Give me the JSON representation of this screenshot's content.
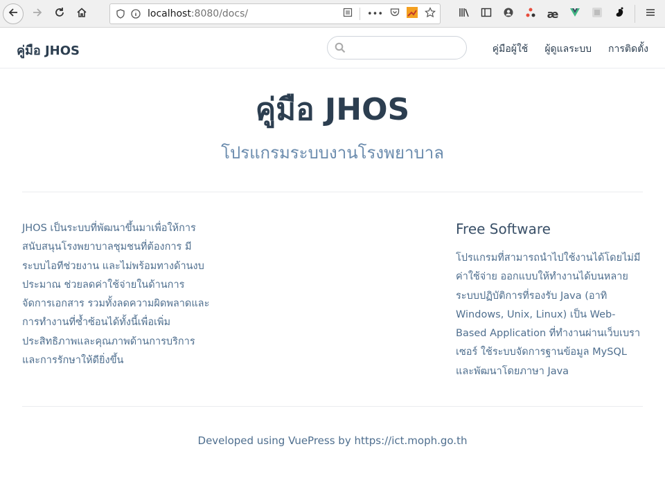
{
  "browser": {
    "url_host": "localhost",
    "url_port": ":8080",
    "url_path": "/docs/"
  },
  "navbar": {
    "site_name": "คู่มือ JHOS",
    "search_placeholder": "",
    "links": [
      {
        "label": "คู่มือผู้ใช้"
      },
      {
        "label": "ผู้ดูแลระบบ"
      },
      {
        "label": "การติดตั้ง"
      }
    ]
  },
  "hero": {
    "title": "คู่มือ JHOS",
    "tagline": "โปรแกรมระบบงานโรงพยาบาล"
  },
  "features": {
    "left_text": "JHOS เป็นระบบที่พัฒนาขึ้นมาเพื่อให้การสนับสนุนโรงพยาบาลชุมชนที่ต้องการ มีระบบไอทีช่วยงาน และไม่พร้อมทางด้านงบประมาณ ช่วยลดค่าใช้จ่ายในด้านการจัดการเอกสาร รวมทั้งลดความผิดพลาดและการทำงานที่ซ้ำซ้อนได้ทั้งนี้เพื่อเพิ่มประสิทธิภาพและคุณภาพด้านการบริการและการรักษาให้ดียิ่งขึ้น",
    "right_title": "Free Software",
    "right_text": "โปรแกรมที่สามารถนำไปใช้งานได้โดยไม่มีค่าใช้จ่าย ออกแบบให้ทำงานได้บนหลายระบบปฏิบัติการที่รองรับ Java (อาทิ Windows, Unix, Linux) เป็น Web-Based Application ที่ทำงานผ่านเว็บเบราเซอร์ ใช้ระบบจัดการฐานข้อมูล MySQL และพัฒนาโดยภาษา Java"
  },
  "footer": {
    "text": "Developed using VuePress by https://ict.moph.go.th"
  }
}
